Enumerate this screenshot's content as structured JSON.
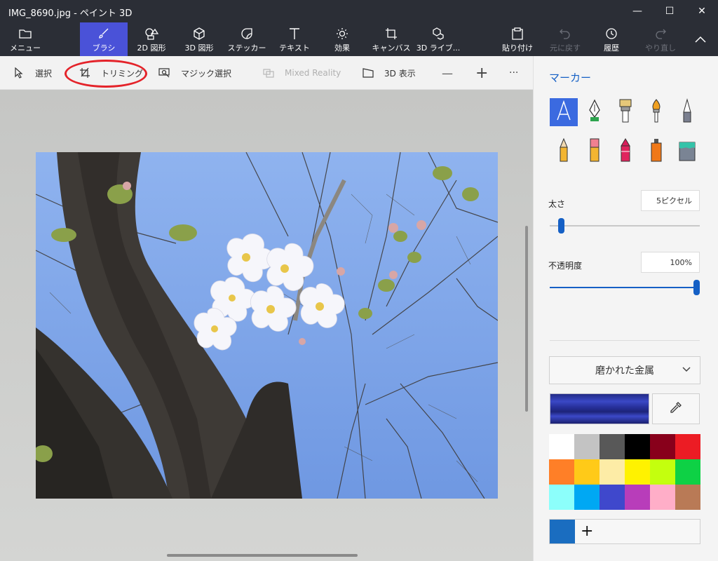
{
  "window": {
    "title": "IMG_8690.jpg - ペイント 3D",
    "minimize": "—",
    "maximize": "☐",
    "close": "✕"
  },
  "ribbon": {
    "tools": [
      {
        "label": "メニュー",
        "icon": "folder-icon"
      },
      {
        "label": "ブラシ",
        "icon": "brush-icon",
        "active": true
      },
      {
        "label": "2D 図形",
        "icon": "shapes-2d-icon"
      },
      {
        "label": "3D 図形",
        "icon": "cube-icon"
      },
      {
        "label": "ステッカー",
        "icon": "sticker-icon"
      },
      {
        "label": "テキスト",
        "icon": "text-icon"
      },
      {
        "label": "効果",
        "icon": "sun-icon"
      },
      {
        "label": "キャンバス",
        "icon": "canvas-icon"
      },
      {
        "label": "3D ライブ...",
        "icon": "library-icon"
      },
      {
        "label": "貼り付け",
        "icon": "paste-icon"
      },
      {
        "label": "元に戻す",
        "icon": "undo-icon",
        "disabled": true
      },
      {
        "label": "履歴",
        "icon": "history-icon"
      },
      {
        "label": "やり直し",
        "icon": "redo-icon",
        "disabled": true
      }
    ]
  },
  "subbar": {
    "select": "選択",
    "crop": "トリミング",
    "magic_select": "マジック選択",
    "mixed_reality": "Mixed Reality",
    "view3d": "3D 表示",
    "zoom_out": "—",
    "zoom_in": "+",
    "more": "···"
  },
  "panel": {
    "title": "マーカー",
    "thickness_label": "太さ",
    "thickness_value": "5ピクセル",
    "thickness_level": 0.06,
    "opacity_label": "不透明度",
    "opacity_value": "100%",
    "opacity_level": 1.0,
    "material": "磨かれた金属",
    "add_color": "+"
  },
  "palette": [
    "#ffffff",
    "#c3c3c3",
    "#585858",
    "#000000",
    "#88001b",
    "#ec1c24",
    "#ff7f27",
    "#ffca18",
    "#fdeca6",
    "#fff200",
    "#c4ff0e",
    "#0ed145",
    "#8cfffb",
    "#00a8f3",
    "#3f48cc",
    "#b83dba",
    "#ffaec8",
    "#b97a56"
  ],
  "colors": {
    "accent": "#1560c5",
    "active_tool": "#4a52d8",
    "current_color": "#1a6dc0",
    "annotation": "#e4232a"
  }
}
